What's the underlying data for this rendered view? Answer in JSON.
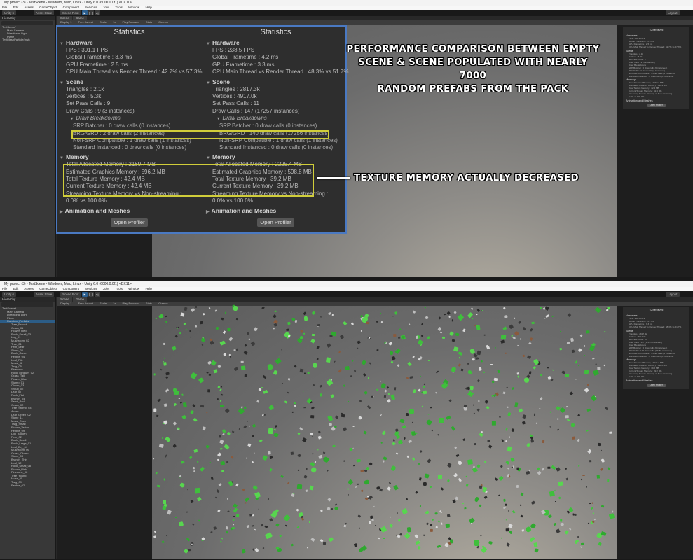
{
  "window": {
    "title": "My project (3) - TestScene - Windows, Mac, Linux - Unity 6.0 (6000.0.0f1) <DX11>",
    "menu": [
      "File",
      "Edit",
      "Assets",
      "GameObject",
      "Component",
      "Services",
      "Jobs",
      "Tools",
      "Window",
      "Help"
    ],
    "toolbar": {
      "account": "Unity 6",
      "cloud": "Asset Store",
      "layout": "Layout",
      "debug": "Scene Root"
    }
  },
  "hierarchy": {
    "tab_label": "Hierarchy",
    "top_items": [
      "TestScene*",
      "Main Camera",
      "Directional Light",
      "Plane",
      "TestMeshParticle(Inst)"
    ],
    "bottom_items": [
      "TestScene*",
      "Main Camera",
      "Directional Light",
      "Plane",
      "Random_Prefabs",
      "Tree_Branch",
      "Grass_01",
      "Flower_Red",
      "Rock_Small_03",
      "Log_01",
      "Mushroom_02",
      "Tree_01",
      "Fern_Leaf",
      "Stone_06",
      "Bush_Green",
      "Pebble_04",
      "Leaf_Pile",
      "Moss_02",
      "Twig_05",
      "Pinecone",
      "Rock_Medium_02",
      "Grass_Tall",
      "Flower_Blue",
      "Stump_01",
      "Clover_03",
      "Shrub_02",
      "Leaf_07",
      "Rock_Flat",
      "Branch_04",
      "Seed_Pod",
      "Grass_02",
      "Tree_Stump_03",
      "Acorn",
      "Leaf_Green_02",
      "Stone_11",
      "Moss_Rock",
      "Twig_Small",
      "Flower_Yellow",
      "Pebble_09",
      "Log_Broken",
      "Fern_02",
      "Bush_Small",
      "Rock_Large_01",
      "Leaf_Dry_04",
      "Mushroom_06",
      "Grass_Clump",
      "Stone_03",
      "Branch_Thin",
      "Leaf_12",
      "Rock_Small_08",
      "Flower_Pink",
      "Pinecone_02",
      "Tree_Young",
      "Moss_05",
      "Twig_09",
      "Pebble_02"
    ]
  },
  "scene": {
    "tabs": [
      "Scene",
      "Game"
    ],
    "toolbar": [
      "Display 1",
      "Free Aspect",
      "Scale",
      "1x",
      "Play Focused",
      "Stats",
      "Gizmos"
    ]
  },
  "stats": {
    "title": "Statistics",
    "left": {
      "hardware": "Hardware",
      "fps": "FPS : 301.1 FPS",
      "global_frametime": "Global Frametime : 3.3 ms",
      "gpu_frametime": "GPU Frametime : 2.5 ms",
      "cpu_main": "CPU Main Thread vs Render Thread : 42.7% vs 57.3%",
      "scene": "Scene",
      "triangles": "Triangles : 2.1k",
      "vertices": "Vertices : 5.3k",
      "set_pass": "Set Pass Calls : 9",
      "draw_calls": "Draw Calls : 9 (3 instances)",
      "draw_breakdowns": "Draw Breakdowns",
      "srp_batcher": "SRP Batcher : 0 draw calls (0 instances)",
      "brg_grd": "BRG/GRD : 2 draw calls (2 instances)",
      "non_srp": "Non-SRP Compatible : 1 draw calls (1 instances)",
      "standard_instanced": "Standard Instanced : 0 draw calls (0 instances)",
      "memory": "Memory",
      "total_alloc": "Total Allocated Memory : 2169.7 MB",
      "est_graphics": "Estimated Graphics Memory : 596.2 MB",
      "total_texture": "Total Texture Memory : 42.4 MB",
      "current_texture": "Current Texture Memory : 42.4 MB",
      "streaming": "Streaming Texture Memory vs Non-streaming :",
      "streaming_val": "0.0% vs 100.0%",
      "anim": "Animation and Meshes",
      "profiler": "Open Profiler"
    },
    "right": {
      "hardware": "Hardware",
      "fps": "FPS : 238.5 FPS",
      "global_frametime": "Global Frametime : 4.2 ms",
      "gpu_frametime": "GPU Frametime : 3.3 ms",
      "cpu_main": "CPU Main Thread vs Render Thread : 48.3% vs 51.7%",
      "scene": "Scene",
      "triangles": "Triangles : 2817.3k",
      "vertices": "Vertices : 4917.0k",
      "set_pass": "Set Pass Calls : 11",
      "draw_calls": "Draw Calls : 147 (17257 instances)",
      "draw_breakdowns": "Draw Breakdowns",
      "srp_batcher": "SRP Batcher : 0 draw calls (0 instances)",
      "brg_grd": "BRG/GRD : 140 draw calls (17256 instances)",
      "non_srp": "Non-SRP Compatible : 1 draw calls (1 instances)",
      "standard_instanced": "Standard Instanced : 0 draw calls (0 instances)",
      "memory": "Memory",
      "total_alloc": "Total Allocated Memory : 2225.4 MB",
      "est_graphics": "Estimated Graphics Memory : 598.8 MB",
      "total_texture": "Total Texture Memory : 39.2 MB",
      "current_texture": "Current Texture Memory : 39.2 MB",
      "streaming": "Streaming Texture Memory vs Non-streaming :",
      "streaming_val": "0.0% vs 100.0%",
      "anim": "Animation and Meshes",
      "profiler": "Open Profiler"
    }
  },
  "callouts": {
    "perf_1": "PERFORMANCE COMPARISON BETWEEN EMPTY",
    "perf_2": "SCENE & SCENE POPULATED WITH NEARLY 7000",
    "perf_3": "RANDOM PREFABS FROM THE PACK",
    "texture": "TEXTURE MEMORY ACTUALLY DECREASED"
  },
  "colors": {
    "highlight_blue": "#4a79c2",
    "highlight_yellow": "#d0cd3a",
    "confetti_green": "#3fbf3c"
  }
}
